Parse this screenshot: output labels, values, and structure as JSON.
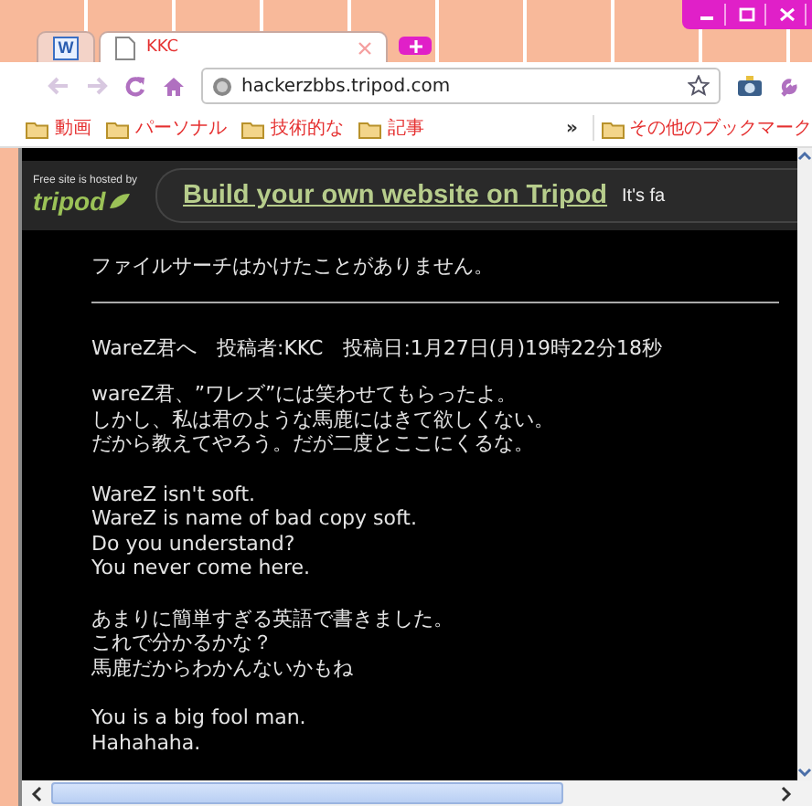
{
  "window": {
    "controls": [
      {
        "kind": "minimize"
      },
      {
        "kind": "maximize"
      },
      {
        "kind": "close"
      }
    ]
  },
  "tabs": [
    {
      "kind": "word",
      "icon_letter": "W",
      "selected": false
    },
    {
      "kind": "page",
      "title": "KKC",
      "selected": true
    }
  ],
  "address_bar": {
    "url": "hackerzbbs.tripod.com"
  },
  "bookmarks": {
    "items": [
      "動画",
      "パーソナル",
      "技術的な",
      "記事"
    ],
    "overflow": "»",
    "other": "その他のブックマーク"
  },
  "banner": {
    "hosted_by": "Free site is hosted by",
    "logo": "tripod",
    "link": "Build your own website on Tripod",
    "tagline": "It's fa"
  },
  "post": {
    "preceding": [
      "ファイルサーチはかけたことがありません。"
    ],
    "header": "WareZ君へ　投稿者:KKC　投稿日:1月27日(月)19時22分18秒",
    "paragraphs": [
      [
        "wareZ君、”ワレズ”には笑わせてもらったよ。",
        "しかし、私は君のような馬鹿にはきて欲しくない。",
        "だから教えてやろう。だが二度とここにくるな。"
      ],
      [
        "WareZ isn't soft.",
        "WareZ is name of bad copy soft.",
        "Do you understand?",
        "You never come here."
      ],
      [
        "あまりに簡単すぎる英語で書きました。",
        "これで分かるかな？",
        "馬鹿だからわかんないかもね"
      ],
      [
        "You is a big fool man.",
        "Hahahaha."
      ]
    ]
  }
}
